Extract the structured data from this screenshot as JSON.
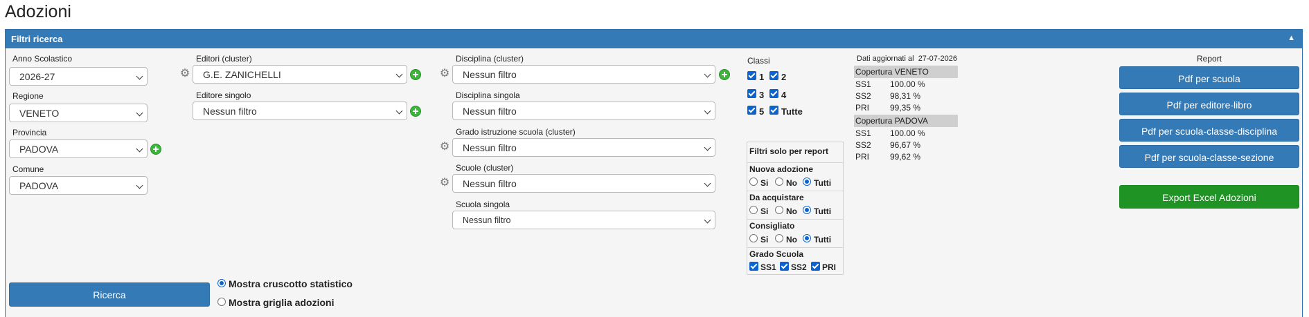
{
  "page": {
    "title": "Adozioni"
  },
  "panel": {
    "title": "Filtri ricerca",
    "collapse_icon": "triangle-up-icon"
  },
  "filters": {
    "anno_label": "Anno Scolastico",
    "anno_value": "2026-27",
    "regione_label": "Regione",
    "regione_value": "VENETO",
    "provincia_label": "Provincia",
    "provincia_value": "PADOVA",
    "comune_label": "Comune",
    "comune_value": "PADOVA",
    "editori_label": "Editori (cluster)",
    "editori_value": "G.E. ZANICHELLI",
    "editore_singolo_label": "Editore singolo",
    "editore_singolo_value": "Nessun filtro",
    "disciplina_cluster_label": "Disciplina (cluster)",
    "disciplina_cluster_value": "Nessun filtro",
    "disciplina_singola_label": "Disciplina singola",
    "disciplina_singola_value": "Nessun filtro",
    "grado_label": "Grado istruzione scuola (cluster)",
    "grado_value": "Nessun filtro",
    "scuole_label": "Scuole (cluster)",
    "scuole_value": "Nessun filtro",
    "scuola_singola_label": "Scuola singola",
    "scuola_singola_value": "Nessun filtro"
  },
  "classi": {
    "title": "Classi",
    "items": [
      {
        "label": "1",
        "checked": true
      },
      {
        "label": "2",
        "checked": true
      },
      {
        "label": "3",
        "checked": true
      },
      {
        "label": "4",
        "checked": true
      },
      {
        "label": "5",
        "checked": true
      },
      {
        "label": "Tutte",
        "checked": true
      }
    ]
  },
  "report_filters": {
    "title": "Filtri solo per report",
    "groups": [
      {
        "label": "Nuova adozione",
        "options": [
          "Si",
          "No",
          "Tutti"
        ],
        "selected": "Tutti"
      },
      {
        "label": "Da acquistare",
        "options": [
          "Si",
          "No",
          "Tutti"
        ],
        "selected": "Tutti"
      },
      {
        "label": "Consigliato",
        "options": [
          "Si",
          "No",
          "Tutti"
        ],
        "selected": "Tutti"
      }
    ],
    "grado_label": "Grado Scuola",
    "grado_items": [
      {
        "label": "SS1",
        "checked": true
      },
      {
        "label": "SS2",
        "checked": true
      },
      {
        "label": "PRI",
        "checked": true
      }
    ]
  },
  "stats": {
    "updated_label": "Dati aggiornati al",
    "updated_date": "27-07-2026",
    "veneto": {
      "title": "Copertura VENETO",
      "rows": [
        {
          "k": "SS1",
          "v": "100.00 %"
        },
        {
          "k": "SS2",
          "v": "98,31 %"
        },
        {
          "k": "PRI",
          "v": "99,35 %"
        }
      ]
    },
    "padova": {
      "title": "Copertura PADOVA",
      "rows": [
        {
          "k": "SS1",
          "v": "100.00 %"
        },
        {
          "k": "SS2",
          "v": "96,67 %"
        },
        {
          "k": "PRI",
          "v": "99,62 %"
        }
      ]
    }
  },
  "report": {
    "title": "Report",
    "pdf_scuola": "Pdf per scuola",
    "pdf_editore": "Pdf per editore-libro",
    "pdf_disciplina": "Pdf per scuola-classe-disciplina",
    "pdf_sezione": "Pdf per scuola-classe-sezione",
    "export": "Export Excel Adozioni"
  },
  "actions": {
    "ricerca": "Ricerca",
    "mostra_cruscotto": "Mostra cruscotto statistico",
    "mostra_griglia": "Mostra griglia adozioni",
    "view_selected": "cruscotto"
  },
  "colors": {
    "primary": "#337ab7",
    "success": "#1f9324",
    "header_bg": "#cfcfcf"
  }
}
